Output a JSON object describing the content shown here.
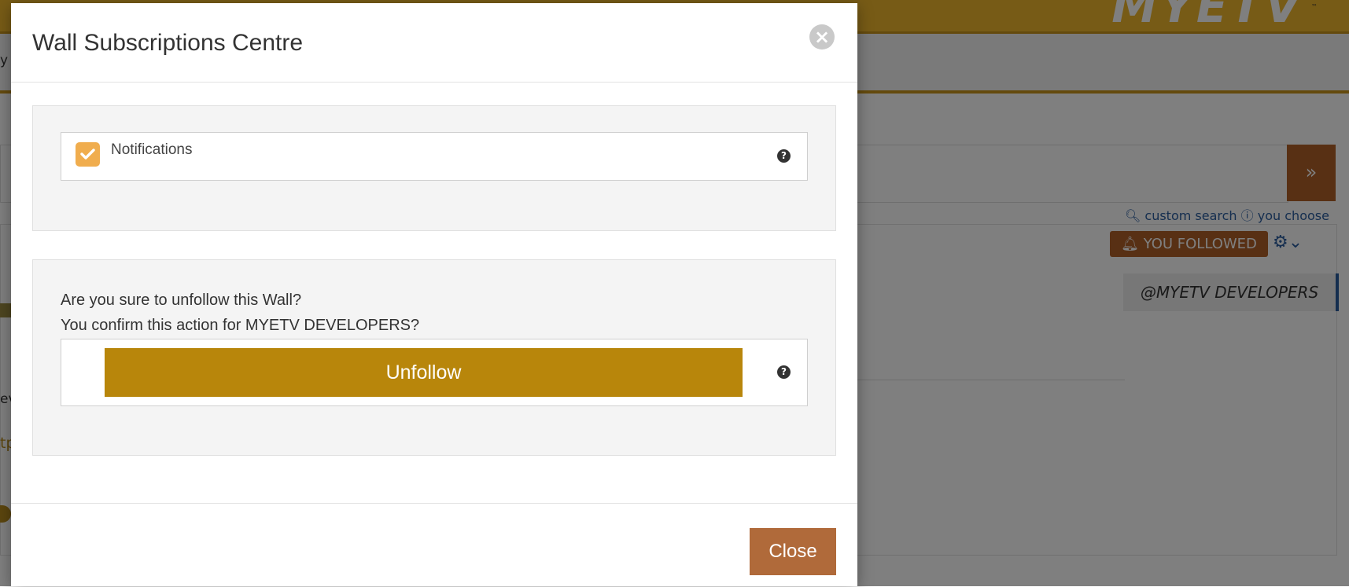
{
  "background": {
    "logo_text": "MYETV",
    "logo_tm": "™",
    "nav_fragment": "y",
    "search_go_icon": "»",
    "search_links": {
      "custom_search": "custom search",
      "you_choose": "you choose"
    },
    "followed_button": "YOU FOLLOWED",
    "wall_tag": "@MYETV DEVELOPERS",
    "text_fragments": [
      "ev",
      "tp"
    ]
  },
  "modal": {
    "title": "Wall Subscriptions Centre",
    "close_icon": "×",
    "notifications": {
      "label": "Notifications",
      "checked": true,
      "help_icon": "?"
    },
    "unfollow": {
      "question": "Are you sure to unfollow this Wall?",
      "confirm_text": "You confirm this action for MYETV DEVELOPERS?",
      "button_label": "Unfollow",
      "help_icon": "?"
    },
    "footer": {
      "close_label": "Close"
    }
  },
  "colors": {
    "header_gold": "#efb62c",
    "unfollow_gold": "#b8860b",
    "close_brown": "#b06a3a",
    "checkbox_orange": "#f0ad4e",
    "link_blue": "#2a5d9f"
  }
}
